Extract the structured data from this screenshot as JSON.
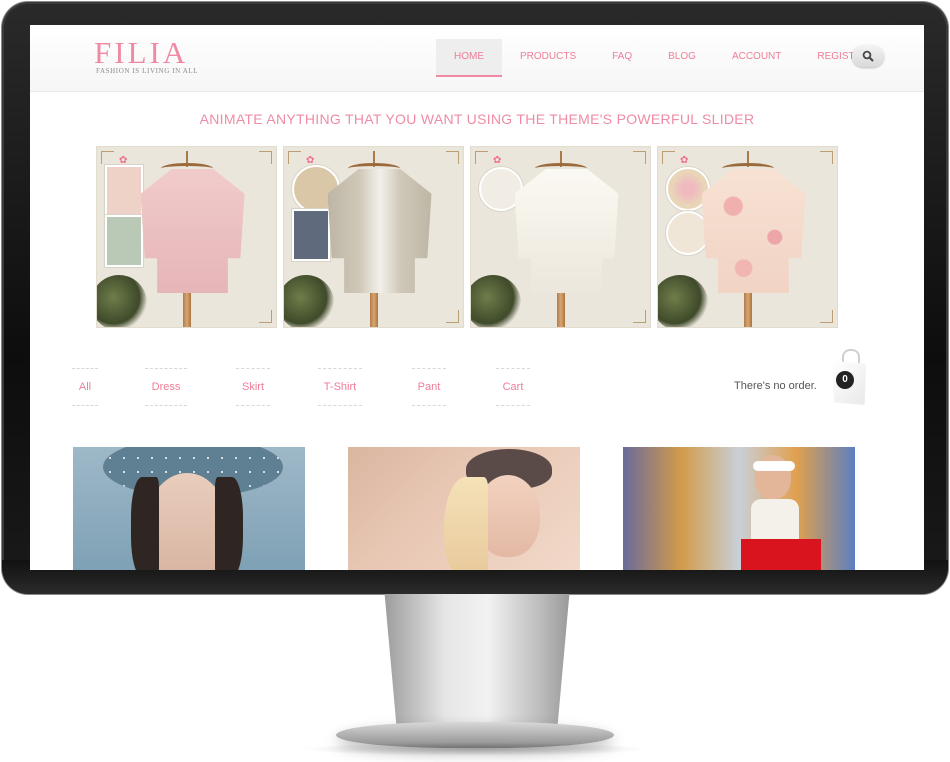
{
  "header": {
    "logo_title": "FILIA",
    "logo_subtitle": "FASHION IS LIVING IN ALL",
    "nav": [
      {
        "label": "HOME",
        "active": true
      },
      {
        "label": "PRODUCTS",
        "active": false
      },
      {
        "label": "FAQ",
        "active": false
      },
      {
        "label": "BLOG",
        "active": false
      },
      {
        "label": "ACCOUNT",
        "active": false
      },
      {
        "label": "REGISTER",
        "active": false
      }
    ],
    "search_icon": "search-icon"
  },
  "slider": {
    "caption": "ANIMATE ANYTHING THAT YOU WANT USING THE THEME'S POWERFUL SLIDER",
    "slides": [
      {
        "garment": "pink-cardigan",
        "garment_color": "#eec3c3"
      },
      {
        "garment": "gray-cardigan",
        "garment_color": "#c9c3b3"
      },
      {
        "garment": "white-blouse",
        "garment_color": "#f3efe6"
      },
      {
        "garment": "floral-blouse",
        "garment_color": "#f1d8c8"
      }
    ]
  },
  "filters": [
    "All",
    "Dress",
    "Skirt",
    "T-Shirt",
    "Pant",
    "Cart"
  ],
  "cart": {
    "status": "There's no order.",
    "count": "0",
    "icon": "shopping-bag-icon"
  },
  "colors": {
    "accent": "#ee7d98",
    "logo": "#f08aa4"
  }
}
